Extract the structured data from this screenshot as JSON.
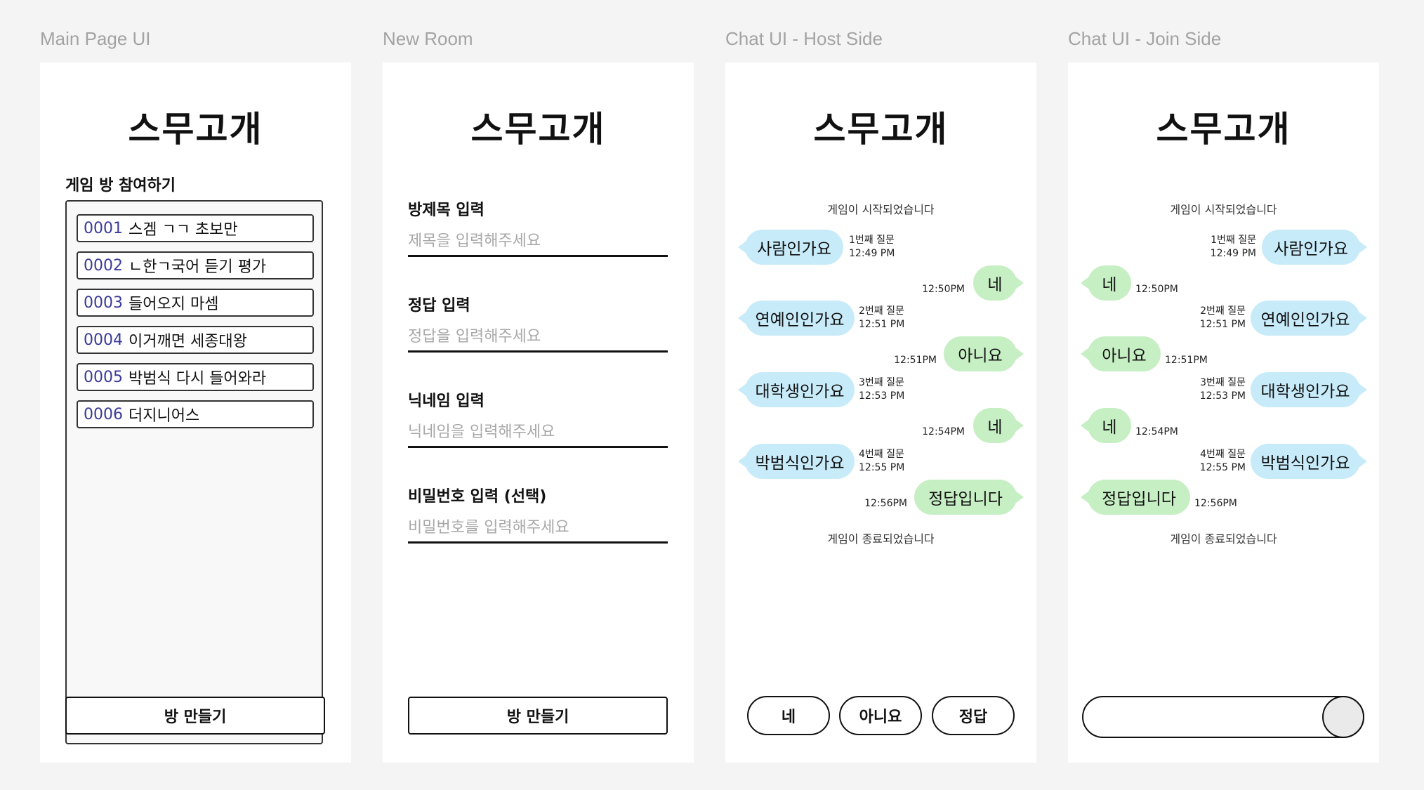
{
  "frames": {
    "main": {
      "label": "Main Page UI"
    },
    "new_room": {
      "label": "New Room"
    },
    "host": {
      "label": "Chat UI - Host Side"
    },
    "join": {
      "label": "Chat UI - Join Side"
    }
  },
  "app": {
    "logo_text": "스무고개"
  },
  "main_page": {
    "section_title": "게임 방 참여하기",
    "rooms": [
      {
        "id": "0001",
        "title": "스겜 ㄱㄱ 초보만"
      },
      {
        "id": "0002",
        "title": "ㄴ한ㄱ국어 듣기 평가"
      },
      {
        "id": "0003",
        "title": "들어오지 마셈"
      },
      {
        "id": "0004",
        "title": "이거깨면 세종대왕"
      },
      {
        "id": "0005",
        "title": "박범식 다시 들어와라"
      },
      {
        "id": "0006",
        "title": "더지니어스"
      }
    ],
    "create_button": "방 만들기"
  },
  "new_room": {
    "title_label": "방제목 입력",
    "title_placeholder": "제목을 입력해주세요",
    "answer_label": "정답 입력",
    "answer_placeholder": "정답을 입력해주세요",
    "nickname_label": "닉네임 입력",
    "nickname_placeholder": "닉네임을 입력해주세요",
    "password_label": "비밀번호 입력 (선택)",
    "password_placeholder": "비밀번호를 입력해주세요",
    "create_button": "방 만들기"
  },
  "chat": {
    "start_text": "게임이 시작되었습니다",
    "end_text": "게임이 종료되었습니다",
    "questions": [
      {
        "text": "사람인가요",
        "label": "1번째 질문",
        "time": "12:49 PM"
      },
      {
        "text": "연예인인가요",
        "label": "2번째 질문",
        "time": "12:51 PM"
      },
      {
        "text": "대학생인가요",
        "label": "3번째 질문",
        "time": "12:53 PM"
      },
      {
        "text": "박범식인가요",
        "label": "4번째 질문",
        "time": "12:55 PM"
      }
    ],
    "answers": [
      {
        "text": "네",
        "time": "12:50PM"
      },
      {
        "text": "아니요",
        "time": "12:51PM"
      },
      {
        "text": "네",
        "time": "12:54PM"
      },
      {
        "text": "정답입니다",
        "time": "12:56PM"
      }
    ],
    "host_buttons": {
      "yes": "네",
      "no": "아니요",
      "correct": "정답"
    }
  },
  "colors": {
    "question_bubble": "#c8ebfa",
    "answer_bubble": "#c7efc4",
    "room_id": "#3a3a9a"
  }
}
